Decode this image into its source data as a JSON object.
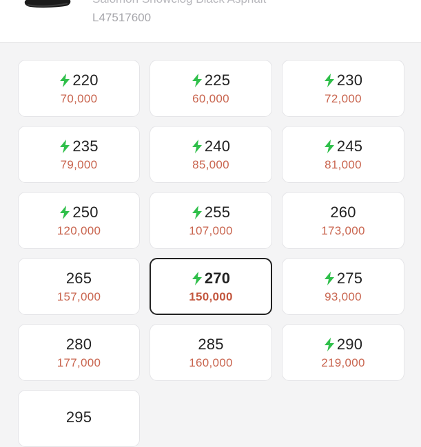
{
  "product": {
    "name": "Salomon Snowclog Black Asphalt",
    "code": "L47517600"
  },
  "colors": {
    "accent_bolt": "#2fbf4a",
    "price": "#c9654f",
    "selected_border": "#222222"
  },
  "sizes": [
    {
      "size": "220",
      "price": "70,000",
      "fast": true,
      "selected": false
    },
    {
      "size": "225",
      "price": "60,000",
      "fast": true,
      "selected": false
    },
    {
      "size": "230",
      "price": "72,000",
      "fast": true,
      "selected": false
    },
    {
      "size": "235",
      "price": "79,000",
      "fast": true,
      "selected": false
    },
    {
      "size": "240",
      "price": "85,000",
      "fast": true,
      "selected": false
    },
    {
      "size": "245",
      "price": "81,000",
      "fast": true,
      "selected": false
    },
    {
      "size": "250",
      "price": "120,000",
      "fast": true,
      "selected": false
    },
    {
      "size": "255",
      "price": "107,000",
      "fast": true,
      "selected": false
    },
    {
      "size": "260",
      "price": "173,000",
      "fast": false,
      "selected": false
    },
    {
      "size": "265",
      "price": "157,000",
      "fast": false,
      "selected": false
    },
    {
      "size": "270",
      "price": "150,000",
      "fast": true,
      "selected": true
    },
    {
      "size": "275",
      "price": "93,000",
      "fast": true,
      "selected": false
    },
    {
      "size": "280",
      "price": "177,000",
      "fast": false,
      "selected": false
    },
    {
      "size": "285",
      "price": "160,000",
      "fast": false,
      "selected": false
    },
    {
      "size": "290",
      "price": "219,000",
      "fast": true,
      "selected": false
    },
    {
      "size": "295",
      "price": "",
      "fast": false,
      "selected": false
    }
  ]
}
